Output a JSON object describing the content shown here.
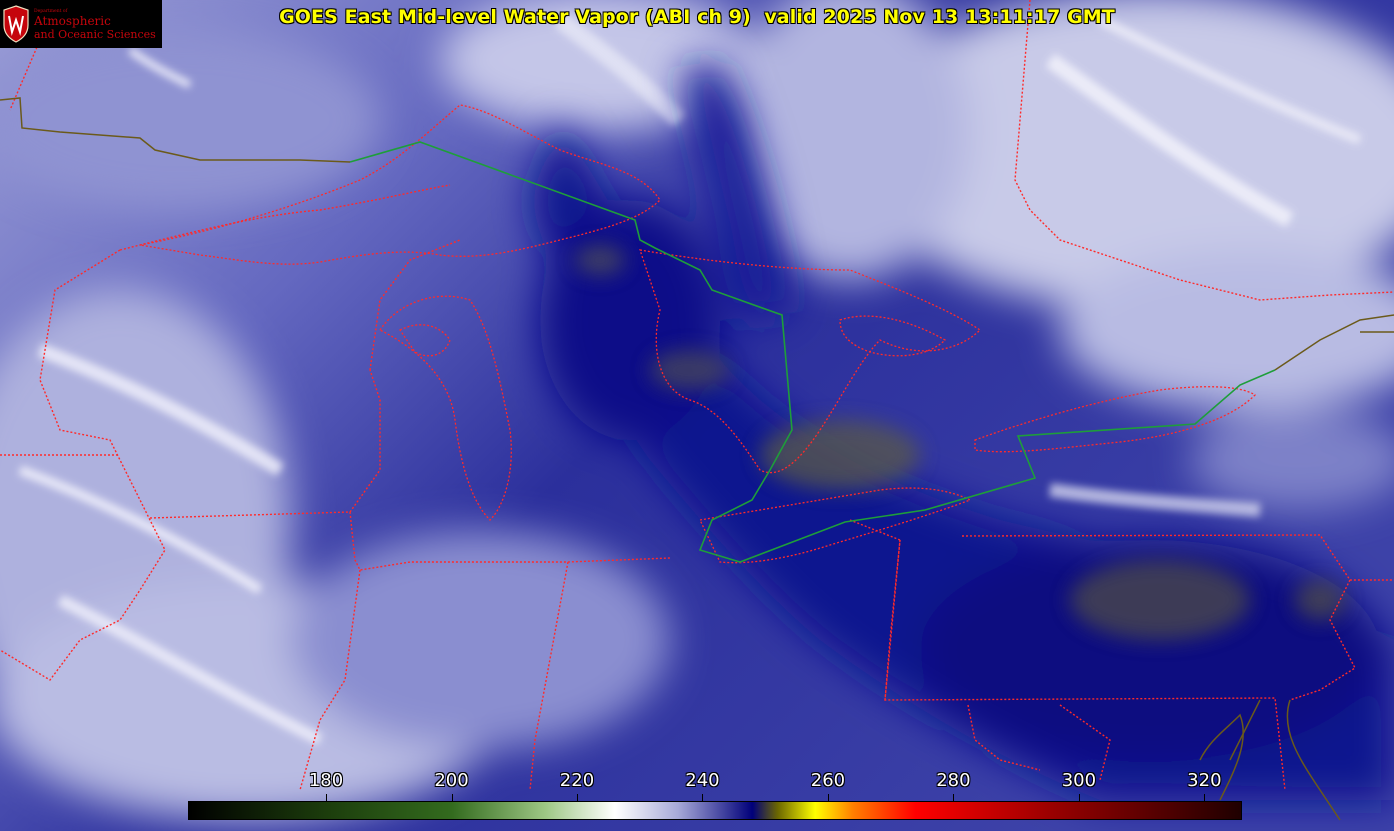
{
  "title": "GOES East Mid-level Water Vapor (ABI ch 9)  valid 2025 Nov 13 13:11:17 GMT",
  "logo": {
    "dept": "Department of",
    "line1": "Atmospheric",
    "line2": "and Oceanic Sciences",
    "icon": "uw-crest-icon"
  },
  "colorbar": {
    "min": 158,
    "max": 326,
    "ticks": [
      180,
      200,
      220,
      240,
      260,
      280,
      300,
      320
    ],
    "tick_labels": [
      "180",
      "200",
      "220",
      "240",
      "260",
      "280",
      "300",
      "320"
    ],
    "stops": [
      {
        "v": 158,
        "c": "#000000"
      },
      {
        "v": 180,
        "c": "#1c3d0c"
      },
      {
        "v": 200,
        "c": "#336b1e"
      },
      {
        "v": 215,
        "c": "#9ec785"
      },
      {
        "v": 226,
        "c": "#ffffff"
      },
      {
        "v": 236,
        "c": "#a8aad8"
      },
      {
        "v": 248,
        "c": "#00007a"
      },
      {
        "v": 252,
        "c": "#6b6600"
      },
      {
        "v": 258,
        "c": "#ffff00"
      },
      {
        "v": 264,
        "c": "#ff8000"
      },
      {
        "v": 274,
        "c": "#ff0000"
      },
      {
        "v": 296,
        "c": "#990000"
      },
      {
        "v": 326,
        "c": "#1f0000"
      }
    ]
  },
  "colors": {
    "state_borders": "#ff2a2a",
    "intl_border": "#1e9e3a",
    "coast": "#6b5a1a",
    "moist": "#d7d9f0",
    "dry": "#000a8a"
  }
}
